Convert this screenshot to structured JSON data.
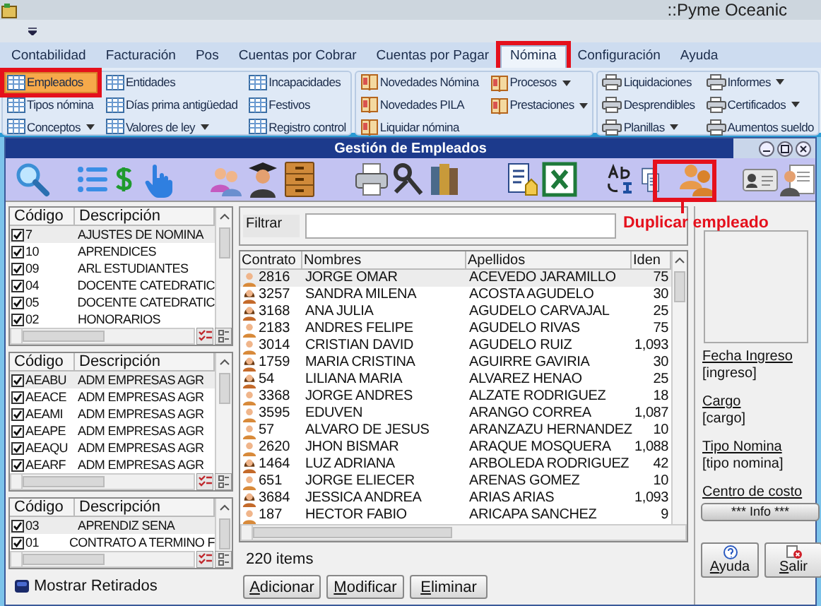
{
  "app_title": "::Pyme Oceanic",
  "ribbon": {
    "tabs": [
      {
        "label": "Contabilidad",
        "selected": false,
        "highlighted": false
      },
      {
        "label": "Facturación",
        "selected": false,
        "highlighted": false
      },
      {
        "label": "Pos",
        "selected": false,
        "highlighted": false
      },
      {
        "label": "Cuentas por Cobrar",
        "selected": false,
        "highlighted": false
      },
      {
        "label": "Cuentas por Pagar",
        "selected": false,
        "highlighted": false
      },
      {
        "label": "Nómina",
        "selected": true,
        "highlighted": true
      },
      {
        "label": "Configuración",
        "selected": false,
        "highlighted": false
      },
      {
        "label": "Ayuda",
        "selected": false,
        "highlighted": false
      }
    ],
    "groups": [
      {
        "columns": [
          [
            {
              "label": "Empleados",
              "kind": "table",
              "dropdown": false,
              "selected": true,
              "highlighted": true
            },
            {
              "label": "Tipos nómina",
              "kind": "table",
              "dropdown": false,
              "selected": false,
              "highlighted": false
            },
            {
              "label": "Conceptos",
              "kind": "table",
              "dropdown": true,
              "selected": false,
              "highlighted": false
            }
          ],
          [
            {
              "label": "Entidades",
              "kind": "table",
              "dropdown": false,
              "selected": false,
              "highlighted": false
            },
            {
              "label": "Días prima antigüedad",
              "kind": "table",
              "dropdown": false,
              "selected": false,
              "highlighted": false
            },
            {
              "label": "Valores de ley",
              "kind": "table",
              "dropdown": true,
              "selected": false,
              "highlighted": false
            }
          ],
          [
            {
              "label": "Incapacidades",
              "kind": "table",
              "dropdown": false,
              "selected": false,
              "highlighted": false
            },
            {
              "label": "Festivos",
              "kind": "table",
              "dropdown": false,
              "selected": false,
              "highlighted": false
            },
            {
              "label": "Registro control",
              "kind": "table",
              "dropdown": false,
              "selected": false,
              "highlighted": false
            }
          ]
        ]
      },
      {
        "columns": [
          [
            {
              "label": "Novedades Nómina",
              "kind": "book",
              "dropdown": false,
              "selected": false,
              "highlighted": false
            },
            {
              "label": "Novedades PILA",
              "kind": "book",
              "dropdown": false,
              "selected": false,
              "highlighted": false
            },
            {
              "label": "Liquidar nómina",
              "kind": "book",
              "dropdown": false,
              "selected": false,
              "highlighted": false
            }
          ],
          [
            {
              "label": "Procesos",
              "kind": "book",
              "dropdown": true,
              "selected": false,
              "highlighted": false
            },
            {
              "label": "Prestaciones",
              "kind": "book",
              "dropdown": true,
              "selected": false,
              "highlighted": false
            }
          ]
        ]
      },
      {
        "columns": [
          [
            {
              "label": "Liquidaciones",
              "kind": "printer",
              "dropdown": false,
              "selected": false,
              "highlighted": false
            },
            {
              "label": "Desprendibles",
              "kind": "printer",
              "dropdown": false,
              "selected": false,
              "highlighted": false
            },
            {
              "label": "Planillas",
              "kind": "printer",
              "dropdown": true,
              "selected": false,
              "highlighted": false
            }
          ],
          [
            {
              "label": "Informes",
              "kind": "printer",
              "dropdown": true,
              "selected": false,
              "highlighted": false
            },
            {
              "label": "Certificados",
              "kind": "printer",
              "dropdown": true,
              "selected": false,
              "highlighted": false
            },
            {
              "label": "Aumentos sueldo",
              "kind": "printer",
              "dropdown": false,
              "selected": false,
              "highlighted": false
            }
          ]
        ]
      }
    ]
  },
  "window": {
    "title": "Gestión de Empleados"
  },
  "annotation": {
    "label": "Duplicar empleado"
  },
  "lists": [
    {
      "columns": [
        "Código",
        "Descripción"
      ],
      "rows": [
        {
          "code": "7",
          "description": "AJUSTES DE NOMINA",
          "checked": true
        },
        {
          "code": "10",
          "description": "APRENDICES",
          "checked": true
        },
        {
          "code": "09",
          "description": "ARL ESTUDIANTES",
          "checked": true
        },
        {
          "code": "04",
          "description": "DOCENTE CATEDRATIC",
          "checked": true
        },
        {
          "code": "05",
          "description": "DOCENTE CATEDRATIC",
          "checked": true
        },
        {
          "code": "02",
          "description": "HONORARIOS",
          "checked": true
        }
      ]
    },
    {
      "columns": [
        "Código",
        "Descripción"
      ],
      "rows": [
        {
          "code": "AEABU",
          "description": "ADM EMPRESAS AGR",
          "checked": true
        },
        {
          "code": "AEACE",
          "description": "ADM EMPRESAS AGR",
          "checked": true
        },
        {
          "code": "AEAMI",
          "description": "ADM EMPRESAS AGR",
          "checked": true
        },
        {
          "code": "AEAPE",
          "description": "ADM EMPRESAS AGR",
          "checked": true
        },
        {
          "code": "AEAQU",
          "description": "ADM EMPRESAS AGR",
          "checked": true
        },
        {
          "code": "AEARF",
          "description": "ADM EMPRESAS AGR",
          "checked": true
        }
      ]
    },
    {
      "columns": [
        "Código",
        "Descripción"
      ],
      "rows": [
        {
          "code": "03",
          "description": "APRENDIZ SENA",
          "checked": true
        },
        {
          "code": "01",
          "description": "CONTRATO A TERMINO F",
          "checked": true
        }
      ]
    }
  ],
  "show_retired": {
    "label": "Mostrar Retirados",
    "on": false
  },
  "filter": {
    "label": "Filtrar"
  },
  "table": {
    "columns": [
      "Contrato",
      "Nombres",
      "Apellidos",
      "Iden"
    ],
    "rows": [
      {
        "kind": "male",
        "cells": [
          "2816",
          "JORGE OMAR",
          "ACEVEDO JARAMILLO",
          "75"
        ]
      },
      {
        "kind": "female",
        "cells": [
          "3257",
          "SANDRA MILENA",
          "ACOSTA AGUDELO",
          "30"
        ]
      },
      {
        "kind": "female",
        "cells": [
          "3168",
          "ANA JULIA",
          "AGUDELO CARVAJAL",
          "25"
        ]
      },
      {
        "kind": "male",
        "cells": [
          "2183",
          "ANDRES FELIPE",
          "AGUDELO RIVAS",
          "75"
        ]
      },
      {
        "kind": "male",
        "cells": [
          "3014",
          "CRISTIAN DAVID",
          "AGUDELO RUIZ",
          "1,093"
        ]
      },
      {
        "kind": "female",
        "cells": [
          "1759",
          "MARIA CRISTINA",
          "AGUIRRE GAVIRIA",
          "30"
        ]
      },
      {
        "kind": "female",
        "cells": [
          "54",
          "LILIANA MARIA",
          "ALVAREZ HENAO",
          "25"
        ]
      },
      {
        "kind": "male",
        "cells": [
          "3368",
          "JORGE ANDRES",
          "ALZATE RODRIGUEZ",
          "18"
        ]
      },
      {
        "kind": "male",
        "cells": [
          "3595",
          "EDUVEN",
          "ARANGO CORREA",
          "1,087"
        ]
      },
      {
        "kind": "male",
        "cells": [
          "57",
          "ALVARO DE JESUS",
          "ARANZAZU HERNANDEZ",
          "10"
        ]
      },
      {
        "kind": "male",
        "cells": [
          "2620",
          "JHON BISMAR",
          "ARAQUE MOSQUERA",
          "1,088"
        ]
      },
      {
        "kind": "female",
        "cells": [
          "1464",
          "LUZ ADRIANA",
          "ARBOLEDA RODRIGUEZ",
          "42"
        ]
      },
      {
        "kind": "male",
        "cells": [
          "651",
          "JORGE ELIECER",
          "ARENAS GOMEZ",
          "10"
        ]
      },
      {
        "kind": "female",
        "cells": [
          "3684",
          "JESSICA ANDREA",
          "ARIAS ARIAS",
          "1,093"
        ]
      },
      {
        "kind": "male",
        "cells": [
          "187",
          "HECTOR FABIO",
          "ARICAPA SANCHEZ",
          "9"
        ]
      }
    ],
    "count": "220 items"
  },
  "actions": [
    "Adicionar",
    "Modificar",
    "Eliminar"
  ],
  "details": [
    {
      "label": "Fecha Ingreso",
      "value": "[ingreso]"
    },
    {
      "label": "Cargo",
      "value": "[cargo]"
    },
    {
      "label": "Tipo Nomina",
      "value": "[tipo nomina]"
    },
    {
      "label": "Centro de costo"
    }
  ],
  "info_button": "*** Info ***",
  "footer_buttons": [
    {
      "kind": "help",
      "label": "Ayuda"
    },
    {
      "kind": "exit",
      "label": "Salir"
    }
  ]
}
